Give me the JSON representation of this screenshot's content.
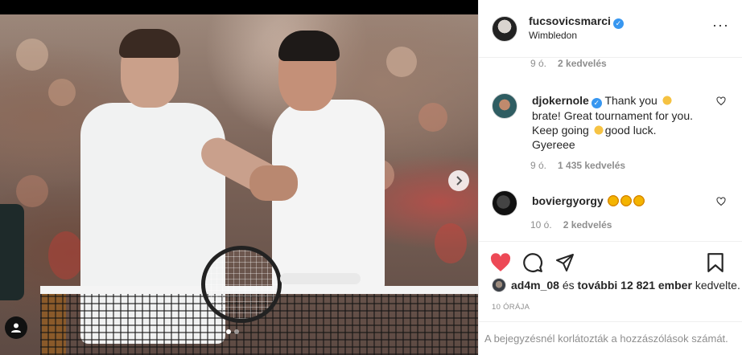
{
  "post": {
    "author": "fucsovicsmarci",
    "location": "Wimbledon",
    "more_icon": "more-horizontal-icon",
    "media": {
      "carousel_next_icon": "chevron-right-icon",
      "tag_icon": "user-tag-icon",
      "slide_count": 2,
      "active_slide": 1
    }
  },
  "comments": [
    {
      "meta_time": "9 ó.",
      "meta_likes": "2 kedvelés"
    },
    {
      "username": "djokernole",
      "verified": true,
      "text_1": "Thank you",
      "text_2": "brate! Great tournament for you.",
      "text_3": "Keep going",
      "text_4": "good luck.",
      "text_5": "Gyereee",
      "time": "9 ó.",
      "likes": "1 435 kedvelés"
    },
    {
      "username": "boviergyorgy",
      "time": "10 ó.",
      "likes": "2 kedvelés"
    }
  ],
  "actions": {
    "like_icon": "heart-filled-icon",
    "comment_icon": "comment-icon",
    "share_icon": "share-icon",
    "save_icon": "bookmark-icon",
    "like_color": "#ed4956"
  },
  "likes_summary": {
    "user": "ad4m_08",
    "connector": "és",
    "others": "további 12 821 ember",
    "suffix": "kedvelte."
  },
  "time_ago": "10 ÓRÁJA",
  "comments_restricted": "A bejegyzésnél korlátozták a hozzászólások számát."
}
